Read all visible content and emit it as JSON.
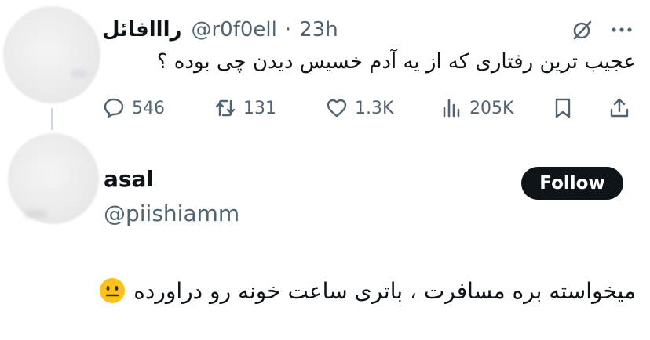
{
  "tweet": {
    "display_name": "رااافائل",
    "handle": "@r0f0ell",
    "separator": "·",
    "time": "23h",
    "text": "عجیب ترین رفتاری که از یه آدم خسیس دیدن چی بوده ؟",
    "stats": {
      "replies": "546",
      "retweets": "131",
      "likes": "1.3K",
      "views": "205K"
    }
  },
  "reply_user": {
    "display_name": "asal",
    "handle": "@piishiamm",
    "follow_label": "Follow"
  },
  "reply": {
    "text": "میخواسته بره مسافرت ، باتری ساعت خونه رو دراورده",
    "emoji": "neutral-face-emoji"
  },
  "colors": {
    "text_primary": "#0f1419",
    "text_secondary": "#536471",
    "follow_bg": "#0f1419",
    "follow_fg": "#ffffff",
    "thread_line": "#cfd9de"
  }
}
